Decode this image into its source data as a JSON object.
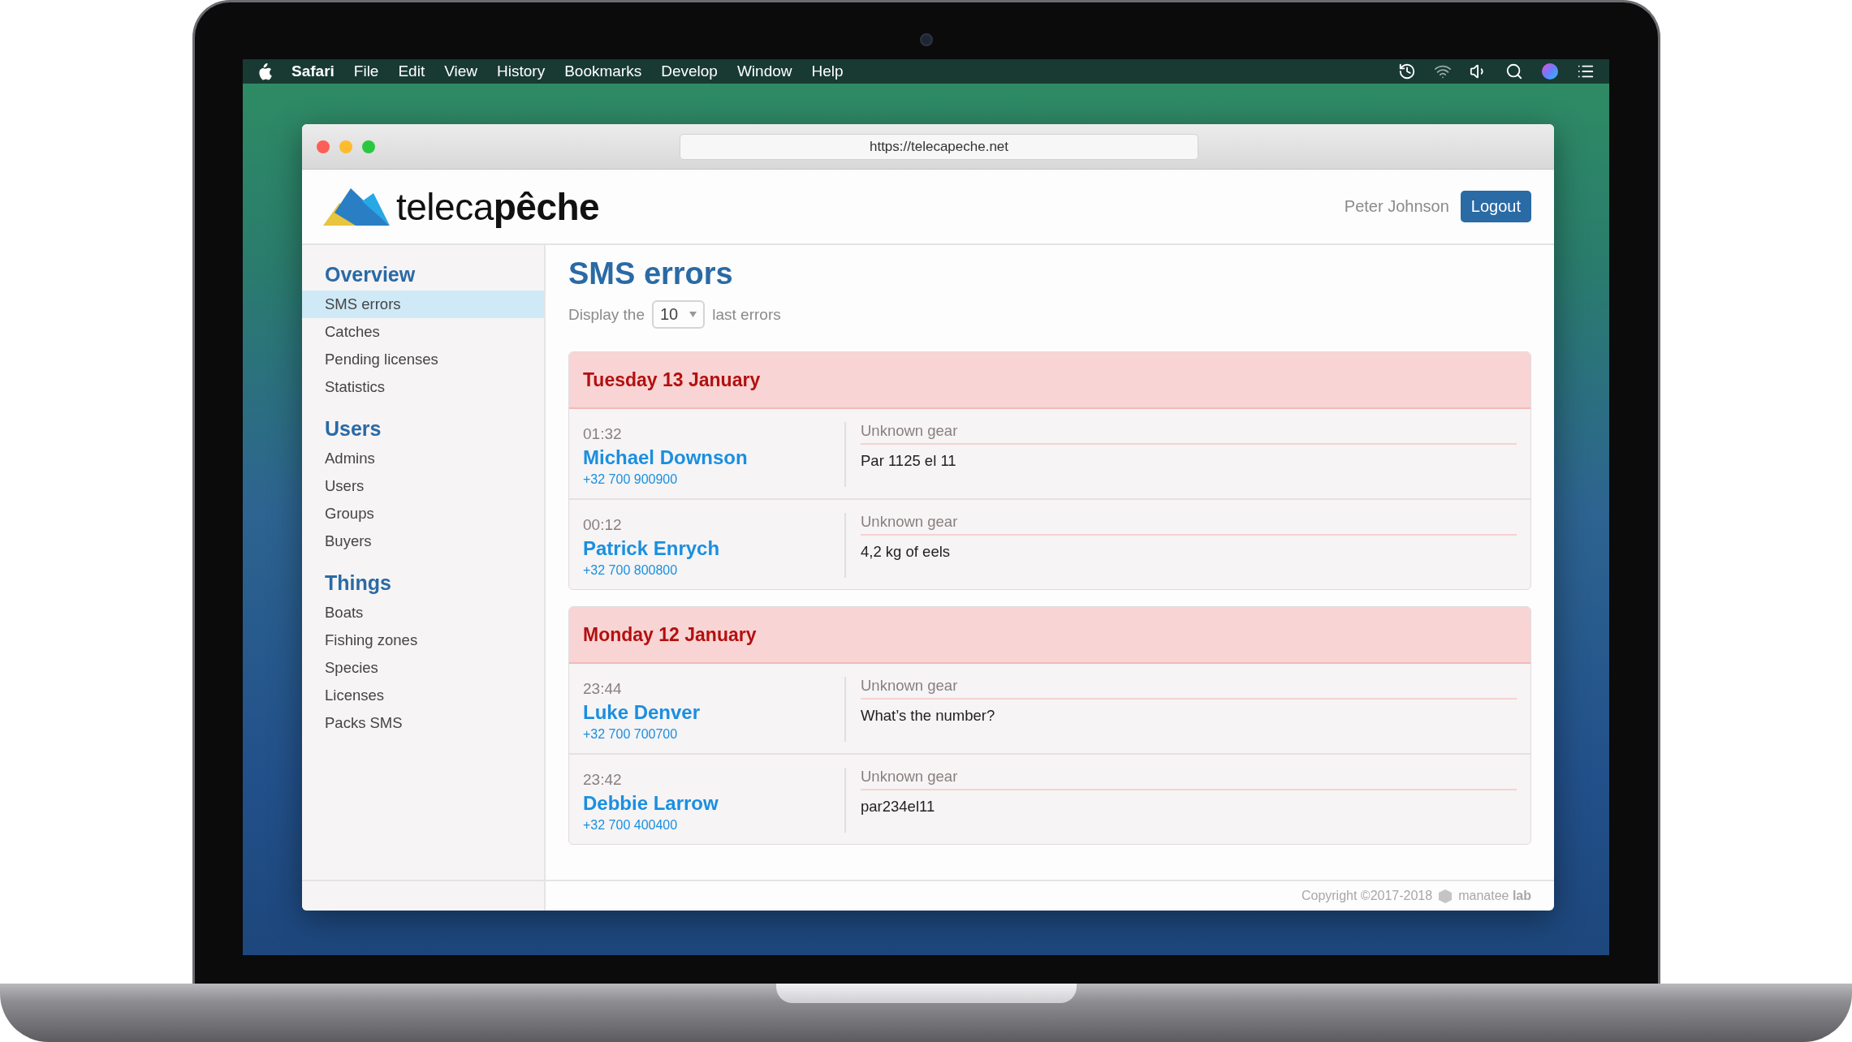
{
  "menubar": {
    "app": "Safari",
    "items": [
      "File",
      "Edit",
      "View",
      "History",
      "Bookmarks",
      "Develop",
      "Window",
      "Help"
    ]
  },
  "browser": {
    "url": "https://telecapeche.net"
  },
  "header": {
    "logo": "teleca**pêche**",
    "user": "Peter Johnson",
    "logout": "Logout"
  },
  "sidebar": {
    "sections": [
      {
        "title": "Overview",
        "items": [
          {
            "label": "SMS errors",
            "selected": true
          },
          {
            "label": "Catches",
            "selected": false
          },
          {
            "label": "Pending licenses",
            "selected": false
          },
          {
            "label": "Statistics",
            "selected": false
          }
        ]
      },
      {
        "title": "Users",
        "items": [
          {
            "label": "Admins",
            "selected": false
          },
          {
            "label": "Users",
            "selected": false
          },
          {
            "label": "Groups",
            "selected": false
          },
          {
            "label": "Buyers",
            "selected": false
          }
        ]
      },
      {
        "title": "Things",
        "items": [
          {
            "label": "Boats",
            "selected": false
          },
          {
            "label": "Fishing zones",
            "selected": false
          },
          {
            "label": "Species",
            "selected": false
          },
          {
            "label": "Licenses",
            "selected": false
          },
          {
            "label": "Packs SMS",
            "selected": false
          }
        ]
      }
    ]
  },
  "page": {
    "title": "SMS errors",
    "filter": {
      "before": "Display the",
      "value": "10",
      "after": "last errors"
    }
  },
  "days": [
    {
      "date": "Tuesday 13 January",
      "errors": [
        {
          "time": "01:32",
          "name": "Michael Downson",
          "phone": "+32 700 900900",
          "label": "Unknown gear",
          "message": "Par 1125 el 11"
        },
        {
          "time": "00:12",
          "name": "Patrick Enrych",
          "phone": "+32 700 800800",
          "label": "Unknown gear",
          "message": "4,2 kg of eels"
        }
      ]
    },
    {
      "date": "Monday 12 January",
      "errors": [
        {
          "time": "23:44",
          "name": "Luke Denver",
          "phone": "+32 700 700700",
          "label": "Unknown gear",
          "message": "What’s the number?"
        },
        {
          "time": "23:42",
          "name": "Debbie Larrow",
          "phone": "+32 700 400400",
          "label": "Unknown gear",
          "message": "par234el11"
        }
      ]
    }
  ],
  "footer": {
    "copyright": "Copyright ©2017-2018",
    "brand": "manatee **lab**"
  }
}
